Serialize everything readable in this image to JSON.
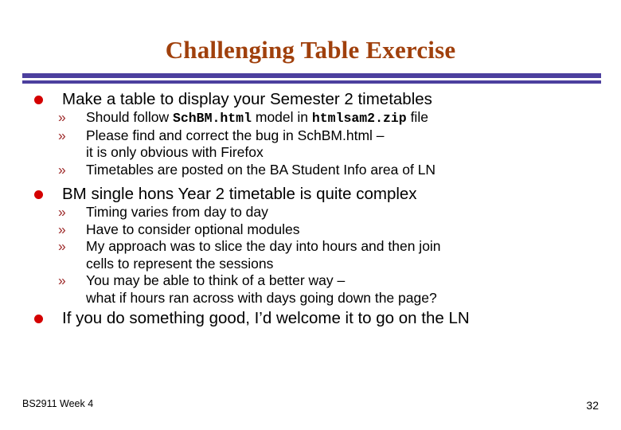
{
  "slide": {
    "title": "Challenging Table Exercise",
    "accent_title_color": "#a0400c",
    "rule_color": "#4c3f9e",
    "bullet_color": "#d40000",
    "sub_bullet_color": "#9e2a2a",
    "sub_bullet_glyph": "»"
  },
  "content": {
    "bullets": [
      {
        "text": "Make a table to display your Semester 2 timetables",
        "subs": [
          {
            "parts": {
              "pre": "Should follow ",
              "code1": "SchBM.html",
              "mid": " model in ",
              "code2": "htmlsam2.zip",
              "post": " file"
            }
          },
          {
            "line1": "Please find and correct the bug in SchBM.html –",
            "line2": "it is only obvious with Firefox"
          },
          {
            "line1": "Timetables are posted on the BA Student Info area of LN"
          }
        ]
      },
      {
        "text": "BM single hons Year 2 timetable is quite complex",
        "subs": [
          {
            "line1": "Timing varies from day to day"
          },
          {
            "line1": "Have to consider optional modules"
          },
          {
            "line1": "My approach was to slice the day into hours and then join",
            "line2": "cells to represent the sessions"
          },
          {
            "line1": "You may be able to think of a better way –",
            "line2": "what if hours ran across with days going down the page?"
          }
        ]
      },
      {
        "text": "If you do something good, I’d welcome it to go on the LN",
        "subs": []
      }
    ]
  },
  "footer": {
    "course": "BS2911 Week 4",
    "page_number": "32"
  }
}
